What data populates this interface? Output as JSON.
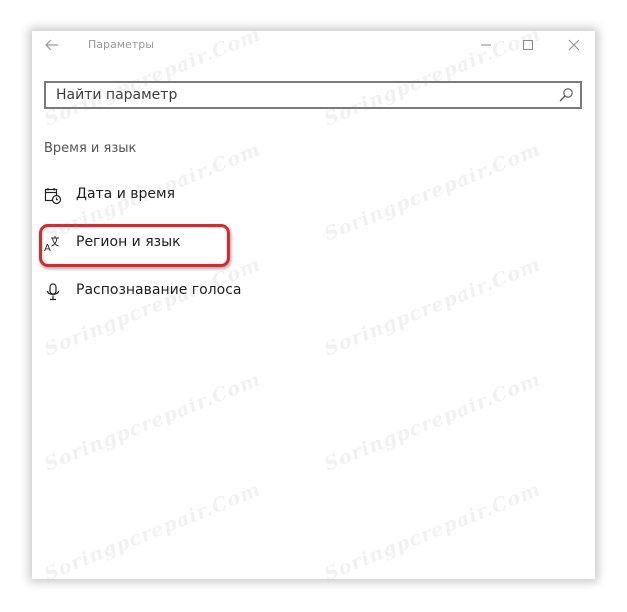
{
  "window": {
    "title": "Параметры"
  },
  "titlebar": {
    "back_icon": "back-arrow-icon",
    "minimize_icon": "minimize-icon",
    "maximize_icon": "maximize-icon",
    "close_icon": "close-icon"
  },
  "search": {
    "placeholder": "Найти параметр",
    "value": "",
    "icon": "search-icon"
  },
  "section": {
    "heading": "Время и язык"
  },
  "nav": {
    "items": [
      {
        "label": "Дата и время",
        "icon": "calendar-clock-icon"
      },
      {
        "label": "Регион и язык",
        "icon": "language-icon",
        "highlighted": true
      },
      {
        "label": "Распознавание голоса",
        "icon": "microphone-icon"
      }
    ]
  },
  "highlight_color": "#d9272e",
  "watermark": {
    "text": "Soringpcrepair.Com"
  }
}
